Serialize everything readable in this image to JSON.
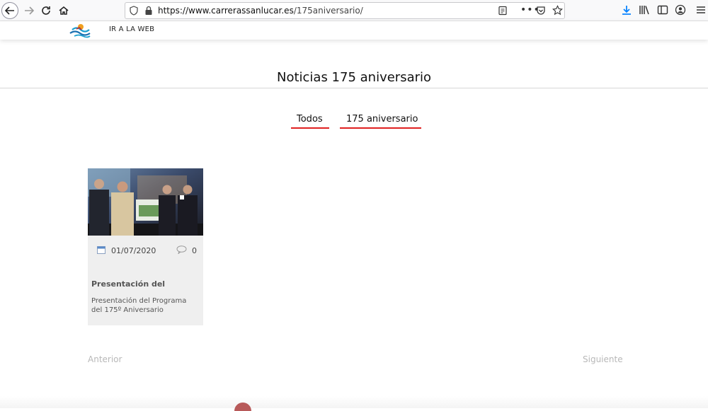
{
  "browser": {
    "url_host": "https://www.carrerassanlucar.es",
    "url_path": "/175aniversario/",
    "icons": [
      "back-icon",
      "forward-icon",
      "reload-icon",
      "home-icon",
      "shield-icon",
      "lock-icon",
      "reader-icon",
      "more-icon",
      "pocket-icon",
      "star-icon",
      "download-icon",
      "library-icon",
      "sidebar-icon",
      "account-icon",
      "menu-icon"
    ],
    "accent": "#0a84ff"
  },
  "site": {
    "nav_link": "IR A LA WEB"
  },
  "page": {
    "title": "Noticias 175 aniversario",
    "filters": [
      {
        "label": "Todos"
      },
      {
        "label": "175 aniversario"
      }
    ],
    "accent": "#e02020"
  },
  "card": {
    "date": "01/07/2020",
    "comments": "0",
    "heading": "Presentación del",
    "text": "Presentación del Programa del 175º Aniversario"
  },
  "pager": {
    "prev": "Anterior",
    "next": "Siguiente"
  }
}
